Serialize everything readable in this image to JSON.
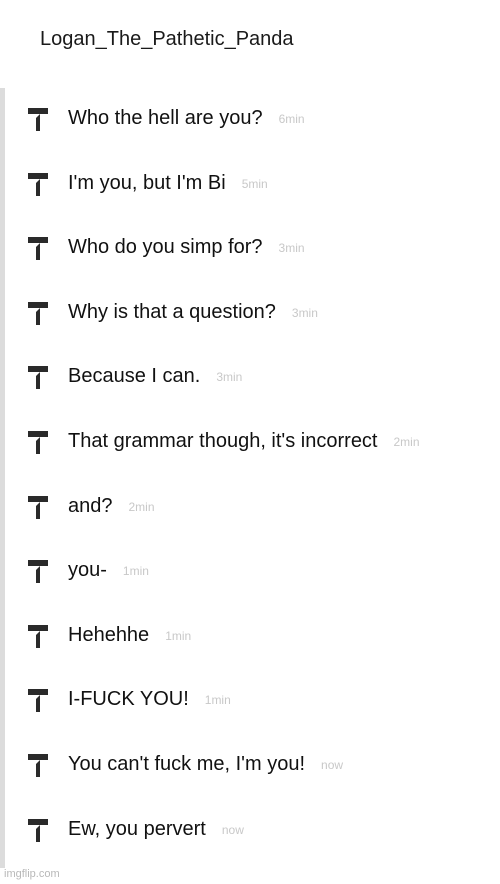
{
  "header": {
    "username": "Logan_The_Pathetic_Panda"
  },
  "comments": [
    {
      "text": "Who the hell are you?",
      "time": "6min",
      "icon": "reply-arrow-icon"
    },
    {
      "text": "I'm you, but I'm Bi",
      "time": "5min",
      "icon": "reply-arrow-icon"
    },
    {
      "text": "Who do you simp for?",
      "time": "3min",
      "icon": "reply-arrow-icon"
    },
    {
      "text": "Why is that a question?",
      "time": "3min",
      "icon": "reply-arrow-icon"
    },
    {
      "text": "Because I can.",
      "time": "3min",
      "icon": "reply-arrow-icon"
    },
    {
      "text": "That grammar though, it's incorrect",
      "time": "2min",
      "icon": "reply-arrow-icon"
    },
    {
      "text": "and?",
      "time": "2min",
      "icon": "reply-arrow-icon"
    },
    {
      "text": "you-",
      "time": "1min",
      "icon": "reply-arrow-icon"
    },
    {
      "text": "Hehehhe",
      "time": "1min",
      "icon": "reply-arrow-icon"
    },
    {
      "text": "I-FUCK YOU!",
      "time": "1min",
      "icon": "reply-arrow-icon"
    },
    {
      "text": "You can't fuck me, I'm you!",
      "time": "now",
      "icon": "reply-arrow-icon"
    },
    {
      "text": "Ew, you pervert",
      "time": "now",
      "icon": "reply-arrow-icon"
    }
  ],
  "footer": {
    "watermark": "imgflip.com"
  },
  "colors": {
    "text": "#111111",
    "timestamp": "#c8c8c8",
    "thread_line": "#dcdcdc",
    "icon": "#2a2a2a"
  }
}
